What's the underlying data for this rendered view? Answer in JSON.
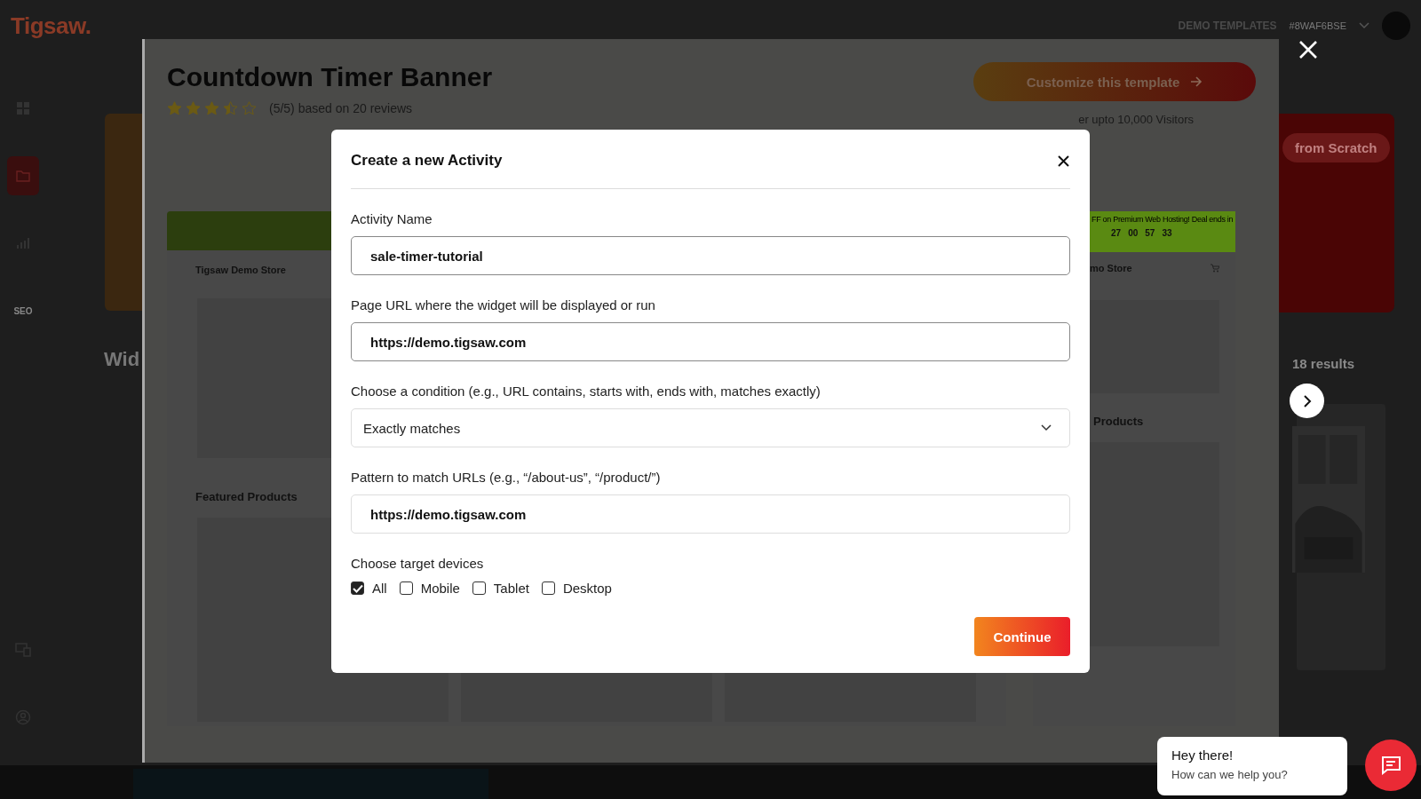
{
  "app": {
    "logo": "Tigsaw.",
    "nav_link": "DEMO TEMPLATES",
    "account_id": "#8WAF6BSE"
  },
  "sidebar": {
    "top": [
      {
        "selected": false
      },
      {
        "selected": true
      },
      {
        "selected": false
      },
      {
        "label": "SEO",
        "selected": false
      }
    ],
    "bottom": [
      {
        "selected": false
      },
      {
        "selected": false
      }
    ]
  },
  "background_page": {
    "heading": "Wid",
    "results": "18 results",
    "scratch_button": "from Scratch"
  },
  "template_preview": {
    "title": "Countdown Timer Banner",
    "stars": 3.5,
    "rating_text": "(5/5) based on 20 reviews",
    "customize_button": "Customize this template",
    "visitors_note": "er upto 10,000 Visitors",
    "previews": [
      {
        "store_name": "Tigsaw Demo Store",
        "section_title": "Featured Products"
      },
      {
        "banner_text": "FF on Premium Web Hosting! Deal ends in",
        "countdown": [
          "27",
          "00",
          "57",
          "33"
        ],
        "store_name": "mo Store",
        "section_title": "Products"
      }
    ]
  },
  "modal": {
    "title": "Create a new Activity",
    "fields": [
      {
        "kind": "text",
        "label": "Activity Name",
        "value": "sale-timer-tutorial"
      },
      {
        "kind": "text",
        "label": "Page URL where the widget will be displayed or run",
        "value": "https://demo.tigsaw.com"
      },
      {
        "kind": "select",
        "label": "Choose a condition (e.g., URL contains, starts with, ends with, matches exactly)",
        "value": "Exactly matches"
      },
      {
        "kind": "text",
        "label": "Pattern to match URLs (e.g., “/about-us”, “/product/”)",
        "value": "https://demo.tigsaw.com"
      }
    ],
    "devices_label": "Choose target devices",
    "devices": [
      {
        "label": "All",
        "checked": true
      },
      {
        "label": "Mobile",
        "checked": false
      },
      {
        "label": "Tablet",
        "checked": false
      },
      {
        "label": "Desktop",
        "checked": false
      }
    ],
    "continue_button": "Continue"
  },
  "chat": {
    "greeting": "Hey there!",
    "prompt": "How can we help you?"
  }
}
